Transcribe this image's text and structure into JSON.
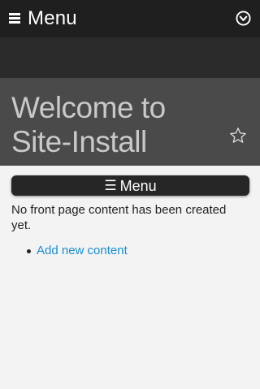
{
  "topbar": {
    "menu_icon": "hamburger-icon",
    "title": "Menu",
    "toggle_icon": "chevron-down-circle-icon"
  },
  "hero": {
    "site_title": "Welcome to Site-Install",
    "star_icon": "star-outline-icon"
  },
  "menu_button": {
    "icon": "☰",
    "label": "Menu"
  },
  "main": {
    "message": "No front page content has been created yet.",
    "links": [
      {
        "label": "Add new content"
      }
    ]
  },
  "colors": {
    "topbar_bg": "#1f1f1f",
    "band_bg": "#2b2b2b",
    "hero_bg": "#4a4a4a",
    "page_bg": "#f3f3f3",
    "link": "#1a8fce"
  }
}
